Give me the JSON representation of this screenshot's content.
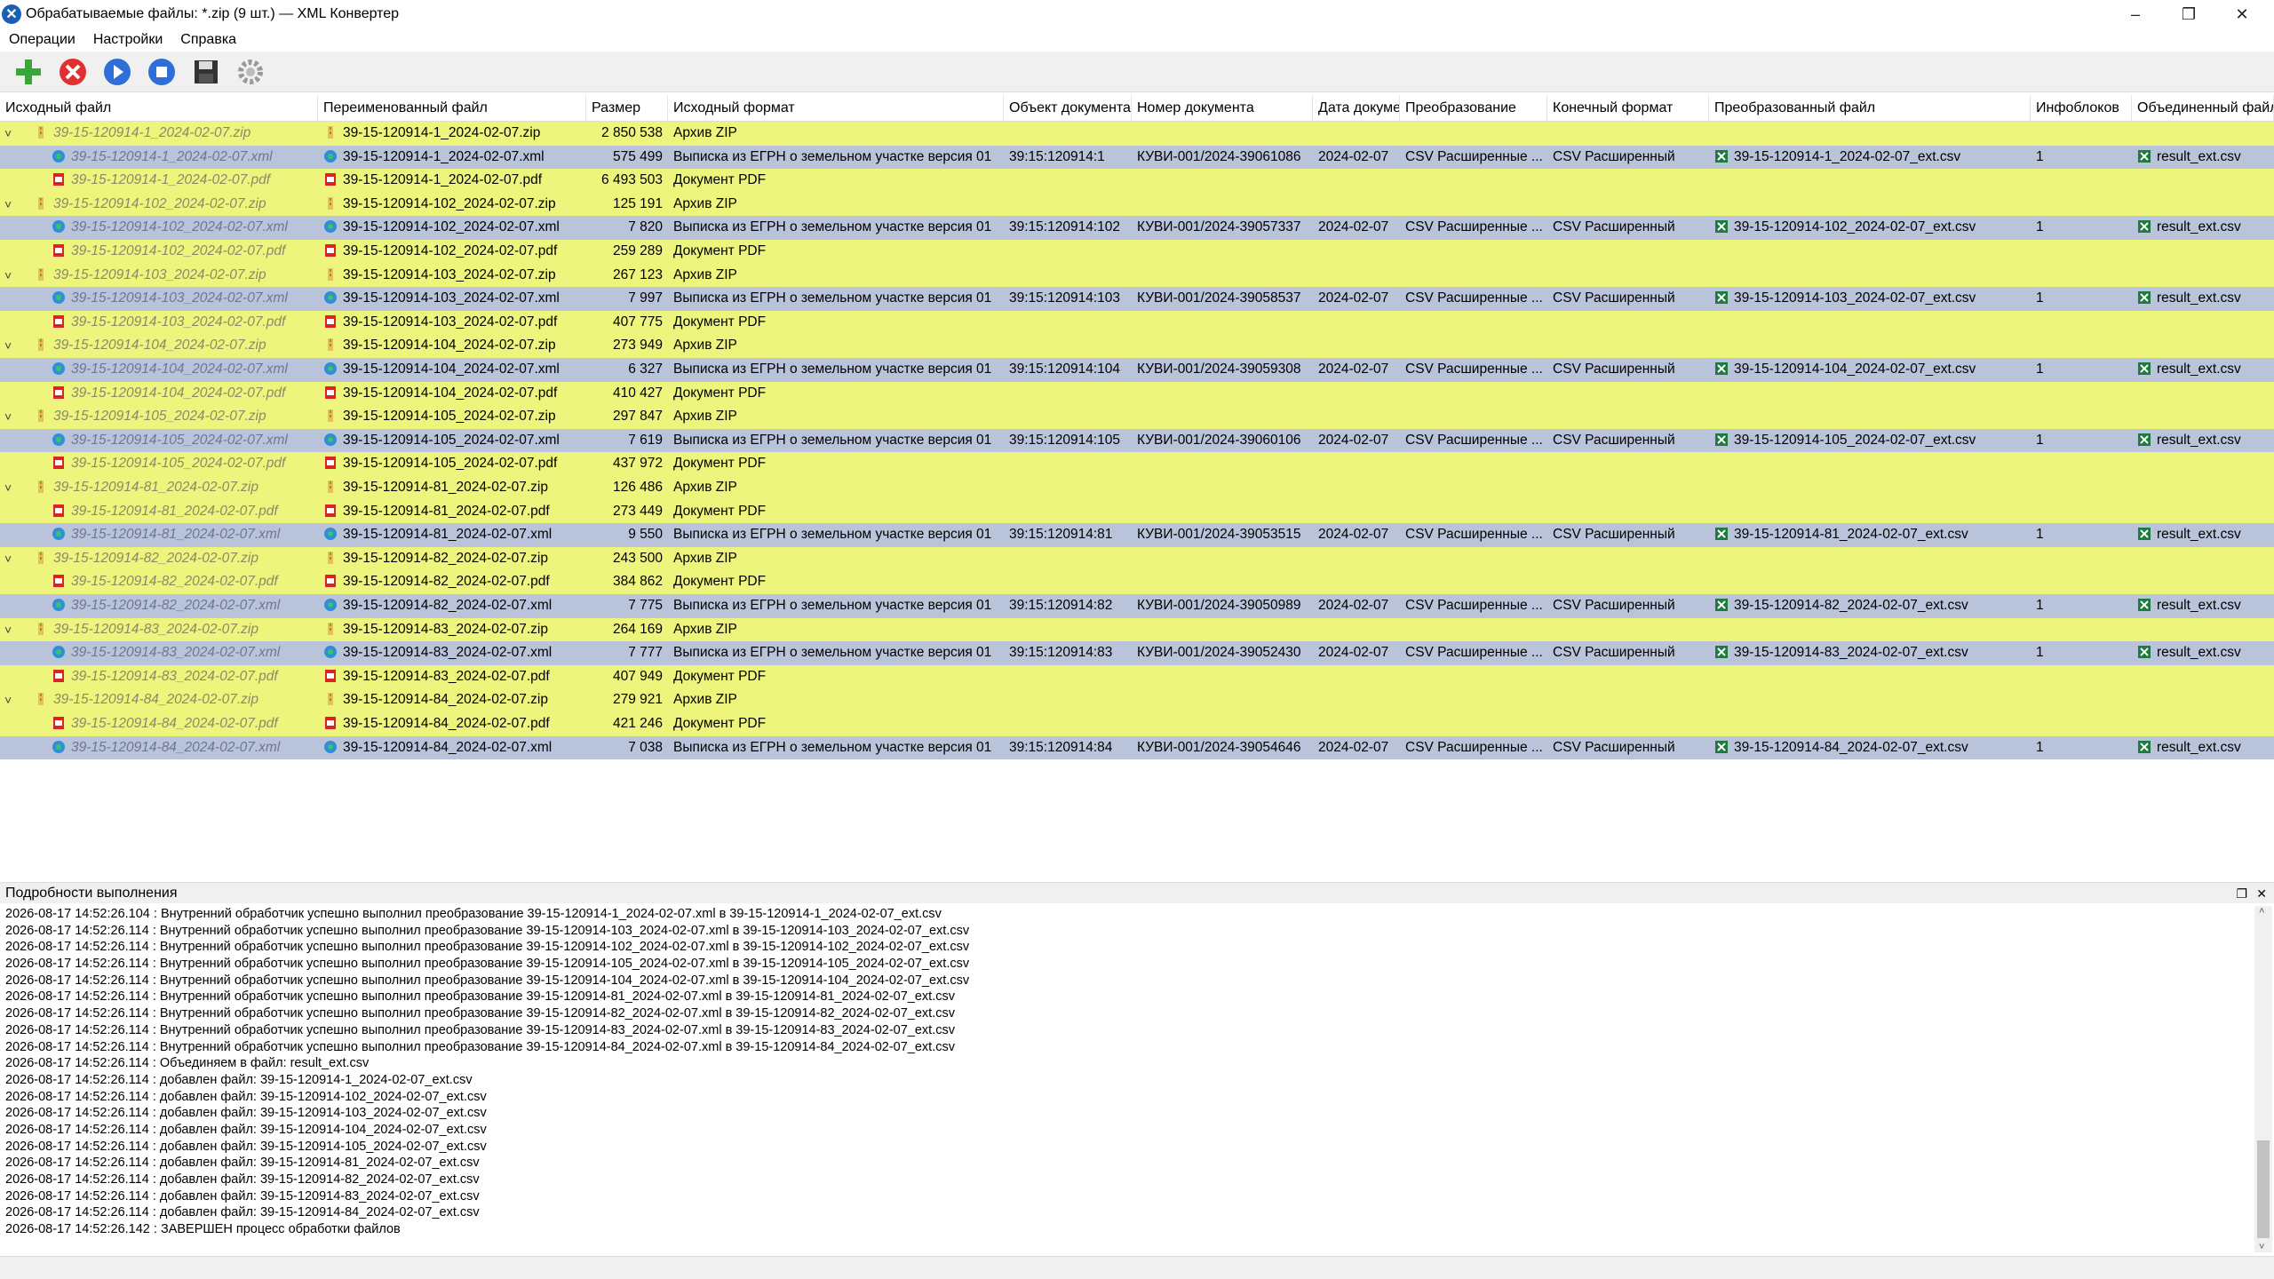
{
  "window": {
    "title": "Обрабатываемые файлы: *.zip (9 шт.) — XML Конвертер",
    "minimize": "–",
    "maximize": "❐",
    "close": "✕"
  },
  "menu": [
    "Операции",
    "Настройки",
    "Справка"
  ],
  "toolbar": [
    "add-icon",
    "remove-icon",
    "forward-icon",
    "stop-icon",
    "save-icon",
    "settings-icon"
  ],
  "columns": [
    "Исходный файл",
    "Переименованный файл",
    "Размер",
    "Исходный формат",
    "Объект документа",
    "Номер документа",
    "Дата докуме",
    "Преобразование",
    "Конечный формат",
    "Преобразованный файл",
    "Инфоблоков",
    "Объединенный файл"
  ],
  "rows": [
    {
      "l": 0,
      "t": "zip",
      "src": "39-15-120914-1_2024-02-07.zip",
      "ren": "39-15-120914-1_2024-02-07.zip",
      "size": "2 850 538",
      "fmt": "Архив ZIP"
    },
    {
      "l": 1,
      "t": "xml",
      "sel": true,
      "src": "39-15-120914-1_2024-02-07.xml",
      "ren": "39-15-120914-1_2024-02-07.xml",
      "size": "575 499",
      "fmt": "Выписка из ЕГРН о земельном участке версия 01",
      "obj": "39:15:120914:1",
      "num": "КУВИ-001/2024-39061086",
      "date": "2024-02-07",
      "conv": "CSV Расширенные ...",
      "final": "CSV Расширенный",
      "out": "39-15-120914-1_2024-02-07_ext.csv",
      "info": "1",
      "merged": "result_ext.csv"
    },
    {
      "l": 1,
      "t": "pdf",
      "src": "39-15-120914-1_2024-02-07.pdf",
      "ren": "39-15-120914-1_2024-02-07.pdf",
      "size": "6 493 503",
      "fmt": "Документ PDF"
    },
    {
      "l": 0,
      "t": "zip",
      "src": "39-15-120914-102_2024-02-07.zip",
      "ren": "39-15-120914-102_2024-02-07.zip",
      "size": "125 191",
      "fmt": "Архив ZIP"
    },
    {
      "l": 1,
      "t": "xml",
      "sel": true,
      "src": "39-15-120914-102_2024-02-07.xml",
      "ren": "39-15-120914-102_2024-02-07.xml",
      "size": "7 820",
      "fmt": "Выписка из ЕГРН о земельном участке версия 01",
      "obj": "39:15:120914:102",
      "num": "КУВИ-001/2024-39057337",
      "date": "2024-02-07",
      "conv": "CSV Расширенные ...",
      "final": "CSV Расширенный",
      "out": "39-15-120914-102_2024-02-07_ext.csv",
      "info": "1",
      "merged": "result_ext.csv"
    },
    {
      "l": 1,
      "t": "pdf",
      "src": "39-15-120914-102_2024-02-07.pdf",
      "ren": "39-15-120914-102_2024-02-07.pdf",
      "size": "259 289",
      "fmt": "Документ PDF"
    },
    {
      "l": 0,
      "t": "zip",
      "src": "39-15-120914-103_2024-02-07.zip",
      "ren": "39-15-120914-103_2024-02-07.zip",
      "size": "267 123",
      "fmt": "Архив ZIP"
    },
    {
      "l": 1,
      "t": "xml",
      "sel": true,
      "src": "39-15-120914-103_2024-02-07.xml",
      "ren": "39-15-120914-103_2024-02-07.xml",
      "size": "7 997",
      "fmt": "Выписка из ЕГРН о земельном участке версия 01",
      "obj": "39:15:120914:103",
      "num": "КУВИ-001/2024-39058537",
      "date": "2024-02-07",
      "conv": "CSV Расширенные ...",
      "final": "CSV Расширенный",
      "out": "39-15-120914-103_2024-02-07_ext.csv",
      "info": "1",
      "merged": "result_ext.csv"
    },
    {
      "l": 1,
      "t": "pdf",
      "src": "39-15-120914-103_2024-02-07.pdf",
      "ren": "39-15-120914-103_2024-02-07.pdf",
      "size": "407 775",
      "fmt": "Документ PDF"
    },
    {
      "l": 0,
      "t": "zip",
      "src": "39-15-120914-104_2024-02-07.zip",
      "ren": "39-15-120914-104_2024-02-07.zip",
      "size": "273 949",
      "fmt": "Архив ZIP"
    },
    {
      "l": 1,
      "t": "xml",
      "sel": true,
      "src": "39-15-120914-104_2024-02-07.xml",
      "ren": "39-15-120914-104_2024-02-07.xml",
      "size": "6 327",
      "fmt": "Выписка из ЕГРН о земельном участке версия 01",
      "obj": "39:15:120914:104",
      "num": "КУВИ-001/2024-39059308",
      "date": "2024-02-07",
      "conv": "CSV Расширенные ...",
      "final": "CSV Расширенный",
      "out": "39-15-120914-104_2024-02-07_ext.csv",
      "info": "1",
      "merged": "result_ext.csv"
    },
    {
      "l": 1,
      "t": "pdf",
      "src": "39-15-120914-104_2024-02-07.pdf",
      "ren": "39-15-120914-104_2024-02-07.pdf",
      "size": "410 427",
      "fmt": "Документ PDF"
    },
    {
      "l": 0,
      "t": "zip",
      "src": "39-15-120914-105_2024-02-07.zip",
      "ren": "39-15-120914-105_2024-02-07.zip",
      "size": "297 847",
      "fmt": "Архив ZIP"
    },
    {
      "l": 1,
      "t": "xml",
      "sel": true,
      "src": "39-15-120914-105_2024-02-07.xml",
      "ren": "39-15-120914-105_2024-02-07.xml",
      "size": "7 619",
      "fmt": "Выписка из ЕГРН о земельном участке версия 01",
      "obj": "39:15:120914:105",
      "num": "КУВИ-001/2024-39060106",
      "date": "2024-02-07",
      "conv": "CSV Расширенные ...",
      "final": "CSV Расширенный",
      "out": "39-15-120914-105_2024-02-07_ext.csv",
      "info": "1",
      "merged": "result_ext.csv"
    },
    {
      "l": 1,
      "t": "pdf",
      "src": "39-15-120914-105_2024-02-07.pdf",
      "ren": "39-15-120914-105_2024-02-07.pdf",
      "size": "437 972",
      "fmt": "Документ PDF"
    },
    {
      "l": 0,
      "t": "zip",
      "src": "39-15-120914-81_2024-02-07.zip",
      "ren": "39-15-120914-81_2024-02-07.zip",
      "size": "126 486",
      "fmt": "Архив ZIP"
    },
    {
      "l": 1,
      "t": "pdf",
      "src": "39-15-120914-81_2024-02-07.pdf",
      "ren": "39-15-120914-81_2024-02-07.pdf",
      "size": "273 449",
      "fmt": "Документ PDF"
    },
    {
      "l": 1,
      "t": "xml",
      "sel": true,
      "src": "39-15-120914-81_2024-02-07.xml",
      "ren": "39-15-120914-81_2024-02-07.xml",
      "size": "9 550",
      "fmt": "Выписка из ЕГРН о земельном участке версия 01",
      "obj": "39:15:120914:81",
      "num": "КУВИ-001/2024-39053515",
      "date": "2024-02-07",
      "conv": "CSV Расширенные ...",
      "final": "CSV Расширенный",
      "out": "39-15-120914-81_2024-02-07_ext.csv",
      "info": "1",
      "merged": "result_ext.csv"
    },
    {
      "l": 0,
      "t": "zip",
      "src": "39-15-120914-82_2024-02-07.zip",
      "ren": "39-15-120914-82_2024-02-07.zip",
      "size": "243 500",
      "fmt": "Архив ZIP"
    },
    {
      "l": 1,
      "t": "pdf",
      "src": "39-15-120914-82_2024-02-07.pdf",
      "ren": "39-15-120914-82_2024-02-07.pdf",
      "size": "384 862",
      "fmt": "Документ PDF"
    },
    {
      "l": 1,
      "t": "xml",
      "sel": true,
      "src": "39-15-120914-82_2024-02-07.xml",
      "ren": "39-15-120914-82_2024-02-07.xml",
      "size": "7 775",
      "fmt": "Выписка из ЕГРН о земельном участке версия 01",
      "obj": "39:15:120914:82",
      "num": "КУВИ-001/2024-39050989",
      "date": "2024-02-07",
      "conv": "CSV Расширенные ...",
      "final": "CSV Расширенный",
      "out": "39-15-120914-82_2024-02-07_ext.csv",
      "info": "1",
      "merged": "result_ext.csv"
    },
    {
      "l": 0,
      "t": "zip",
      "src": "39-15-120914-83_2024-02-07.zip",
      "ren": "39-15-120914-83_2024-02-07.zip",
      "size": "264 169",
      "fmt": "Архив ZIP"
    },
    {
      "l": 1,
      "t": "xml",
      "sel": true,
      "src": "39-15-120914-83_2024-02-07.xml",
      "ren": "39-15-120914-83_2024-02-07.xml",
      "size": "7 777",
      "fmt": "Выписка из ЕГРН о земельном участке версия 01",
      "obj": "39:15:120914:83",
      "num": "КУВИ-001/2024-39052430",
      "date": "2024-02-07",
      "conv": "CSV Расширенные ...",
      "final": "CSV Расширенный",
      "out": "39-15-120914-83_2024-02-07_ext.csv",
      "info": "1",
      "merged": "result_ext.csv"
    },
    {
      "l": 1,
      "t": "pdf",
      "src": "39-15-120914-83_2024-02-07.pdf",
      "ren": "39-15-120914-83_2024-02-07.pdf",
      "size": "407 949",
      "fmt": "Документ PDF"
    },
    {
      "l": 0,
      "t": "zip",
      "src": "39-15-120914-84_2024-02-07.zip",
      "ren": "39-15-120914-84_2024-02-07.zip",
      "size": "279 921",
      "fmt": "Архив ZIP"
    },
    {
      "l": 1,
      "t": "pdf",
      "src": "39-15-120914-84_2024-02-07.pdf",
      "ren": "39-15-120914-84_2024-02-07.pdf",
      "size": "421 246",
      "fmt": "Документ PDF"
    },
    {
      "l": 1,
      "t": "xml",
      "sel": true,
      "src": "39-15-120914-84_2024-02-07.xml",
      "ren": "39-15-120914-84_2024-02-07.xml",
      "size": "7 038",
      "fmt": "Выписка из ЕГРН о земельном участке версия 01",
      "obj": "39:15:120914:84",
      "num": "КУВИ-001/2024-39054646",
      "date": "2024-02-07",
      "conv": "CSV Расширенные ...",
      "final": "CSV Расширенный",
      "out": "39-15-120914-84_2024-02-07_ext.csv",
      "info": "1",
      "merged": "result_ext.csv"
    }
  ],
  "details": {
    "title": "Подробности выполнения",
    "lines": [
      "2026-08-17 14:52:26.104 : Внутренний обработчик успешно выполнил преобразование 39-15-120914-1_2024-02-07.xml в 39-15-120914-1_2024-02-07_ext.csv",
      "2026-08-17 14:52:26.114 : Внутренний обработчик успешно выполнил преобразование 39-15-120914-103_2024-02-07.xml в 39-15-120914-103_2024-02-07_ext.csv",
      "2026-08-17 14:52:26.114 : Внутренний обработчик успешно выполнил преобразование 39-15-120914-102_2024-02-07.xml в 39-15-120914-102_2024-02-07_ext.csv",
      "2026-08-17 14:52:26.114 : Внутренний обработчик успешно выполнил преобразование 39-15-120914-105_2024-02-07.xml в 39-15-120914-105_2024-02-07_ext.csv",
      "2026-08-17 14:52:26.114 : Внутренний обработчик успешно выполнил преобразование 39-15-120914-104_2024-02-07.xml в 39-15-120914-104_2024-02-07_ext.csv",
      "2026-08-17 14:52:26.114 : Внутренний обработчик успешно выполнил преобразование 39-15-120914-81_2024-02-07.xml в 39-15-120914-81_2024-02-07_ext.csv",
      "2026-08-17 14:52:26.114 : Внутренний обработчик успешно выполнил преобразование 39-15-120914-82_2024-02-07.xml в 39-15-120914-82_2024-02-07_ext.csv",
      "2026-08-17 14:52:26.114 : Внутренний обработчик успешно выполнил преобразование 39-15-120914-83_2024-02-07.xml в 39-15-120914-83_2024-02-07_ext.csv",
      "2026-08-17 14:52:26.114 : Внутренний обработчик успешно выполнил преобразование 39-15-120914-84_2024-02-07.xml в 39-15-120914-84_2024-02-07_ext.csv",
      "2026-08-17 14:52:26.114 : Объединяем в файл: result_ext.csv",
      "2026-08-17 14:52:26.114 : добавлен файл: 39-15-120914-1_2024-02-07_ext.csv",
      "2026-08-17 14:52:26.114 : добавлен файл: 39-15-120914-102_2024-02-07_ext.csv",
      "2026-08-17 14:52:26.114 : добавлен файл: 39-15-120914-103_2024-02-07_ext.csv",
      "2026-08-17 14:52:26.114 : добавлен файл: 39-15-120914-104_2024-02-07_ext.csv",
      "2026-08-17 14:52:26.114 : добавлен файл: 39-15-120914-105_2024-02-07_ext.csv",
      "2026-08-17 14:52:26.114 : добавлен файл: 39-15-120914-81_2024-02-07_ext.csv",
      "2026-08-17 14:52:26.114 : добавлен файл: 39-15-120914-82_2024-02-07_ext.csv",
      "2026-08-17 14:52:26.114 : добавлен файл: 39-15-120914-83_2024-02-07_ext.csv",
      "2026-08-17 14:52:26.114 : добавлен файл: 39-15-120914-84_2024-02-07_ext.csv",
      "2026-08-17 14:52:26.142 : ЗАВЕРШЕН процесс обработки файлов"
    ]
  },
  "colors": {
    "row_selected": "#b9c4da",
    "row_normal": "#eef57c"
  }
}
